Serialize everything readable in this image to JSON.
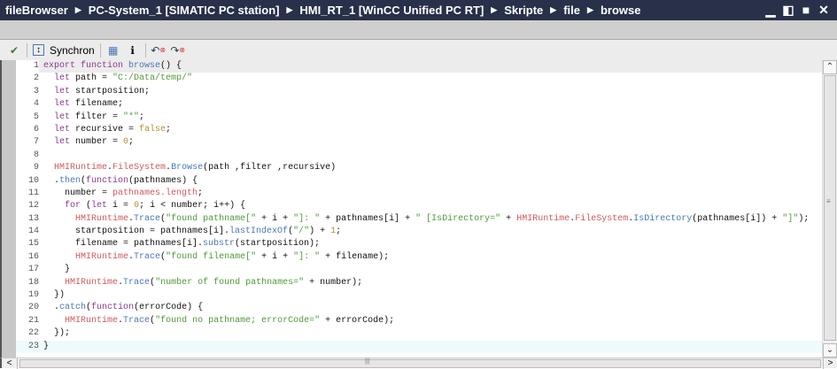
{
  "breadcrumb": [
    "fileBrowser",
    "PC-System_1 [SIMATIC PC station]",
    "HMI_RT_1 [WinCC Unified PC RT]",
    "Skripte",
    "file",
    "browse"
  ],
  "toolbar": {
    "synchron_label": "Synchron"
  },
  "code_lines": [
    [
      [
        "k",
        "export function "
      ],
      [
        "m",
        "browse"
      ],
      [
        "p",
        "() {"
      ]
    ],
    [
      [
        "k",
        "  let "
      ],
      [
        "p",
        "path = "
      ],
      [
        "s",
        "\"C:/Data/temp/\""
      ]
    ],
    [
      [
        "k",
        "  let "
      ],
      [
        "p",
        "startposition;"
      ]
    ],
    [
      [
        "k",
        "  let "
      ],
      [
        "p",
        "filename;"
      ]
    ],
    [
      [
        "k",
        "  let "
      ],
      [
        "p",
        "filter = "
      ],
      [
        "s",
        "\"*\""
      ],
      [
        "p",
        ";"
      ]
    ],
    [
      [
        "k",
        "  let "
      ],
      [
        "p",
        "recursive = "
      ],
      [
        "n",
        "false"
      ],
      [
        "p",
        ";"
      ]
    ],
    [
      [
        "k",
        "  let "
      ],
      [
        "p",
        "number = "
      ],
      [
        "n",
        "0"
      ],
      [
        "p",
        ";"
      ]
    ],
    [
      [
        "p",
        ""
      ]
    ],
    [
      [
        "r",
        "  HMIRuntime"
      ],
      [
        "p",
        "."
      ],
      [
        "r",
        "FileSystem"
      ],
      [
        "p",
        "."
      ],
      [
        "m",
        "Browse"
      ],
      [
        "p",
        "(path ,filter ,recursive)"
      ]
    ],
    [
      [
        "p",
        "  ."
      ],
      [
        "m",
        "then"
      ],
      [
        "p",
        "("
      ],
      [
        "k",
        "function"
      ],
      [
        "p",
        "(pathnames) {"
      ]
    ],
    [
      [
        "p",
        "    number = "
      ],
      [
        "r",
        "pathnames.length"
      ],
      [
        "p",
        ";"
      ]
    ],
    [
      [
        "k",
        "    for "
      ],
      [
        "p",
        "("
      ],
      [
        "k",
        "let "
      ],
      [
        "p",
        "i = "
      ],
      [
        "n",
        "0"
      ],
      [
        "p",
        "; i < number; i++) {"
      ]
    ],
    [
      [
        "r",
        "      HMIRuntime"
      ],
      [
        "p",
        "."
      ],
      [
        "m",
        "Trace"
      ],
      [
        "p",
        "("
      ],
      [
        "s",
        "\"found pathname[\""
      ],
      [
        "p",
        " + i + "
      ],
      [
        "s",
        "\"]: \""
      ],
      [
        "p",
        " + pathnames[i] + "
      ],
      [
        "s",
        "\" [IsDirectory=\""
      ],
      [
        "p",
        " + "
      ],
      [
        "r",
        "HMIRuntime"
      ],
      [
        "p",
        "."
      ],
      [
        "r",
        "FileSystem"
      ],
      [
        "p",
        "."
      ],
      [
        "m",
        "IsDirectory"
      ],
      [
        "p",
        "(pathnames[i]) + "
      ],
      [
        "s",
        "\"]\""
      ],
      [
        "p",
        ");"
      ]
    ],
    [
      [
        "p",
        "      startposition = pathnames[i]."
      ],
      [
        "m",
        "lastIndexOf"
      ],
      [
        "p",
        "("
      ],
      [
        "s",
        "\"/\""
      ],
      [
        "p",
        ") + "
      ],
      [
        "n",
        "1"
      ],
      [
        "p",
        ";"
      ]
    ],
    [
      [
        "p",
        "      filename = pathnames[i]."
      ],
      [
        "m",
        "substr"
      ],
      [
        "p",
        "(startposition);"
      ]
    ],
    [
      [
        "r",
        "      HMIRuntime"
      ],
      [
        "p",
        "."
      ],
      [
        "m",
        "Trace"
      ],
      [
        "p",
        "("
      ],
      [
        "s",
        "\"found filename[\""
      ],
      [
        "p",
        " + i + "
      ],
      [
        "s",
        "\"]: \""
      ],
      [
        "p",
        " + filename);"
      ]
    ],
    [
      [
        "p",
        "    }"
      ]
    ],
    [
      [
        "r",
        "    HMIRuntime"
      ],
      [
        "p",
        "."
      ],
      [
        "m",
        "Trace"
      ],
      [
        "p",
        "("
      ],
      [
        "s",
        "\"number of found pathnames=\""
      ],
      [
        "p",
        " + number);"
      ]
    ],
    [
      [
        "p",
        "  })"
      ]
    ],
    [
      [
        "p",
        "  ."
      ],
      [
        "m",
        "catch"
      ],
      [
        "p",
        "("
      ],
      [
        "k",
        "function"
      ],
      [
        "p",
        "(errorCode) {"
      ]
    ],
    [
      [
        "r",
        "    HMIRuntime"
      ],
      [
        "p",
        "."
      ],
      [
        "m",
        "Trace"
      ],
      [
        "p",
        "("
      ],
      [
        "s",
        "\"found no pathname; errorCode=\""
      ],
      [
        "p",
        " + errorCode);"
      ]
    ],
    [
      [
        "p",
        "  });"
      ]
    ],
    [
      [
        "p",
        "}"
      ]
    ]
  ]
}
